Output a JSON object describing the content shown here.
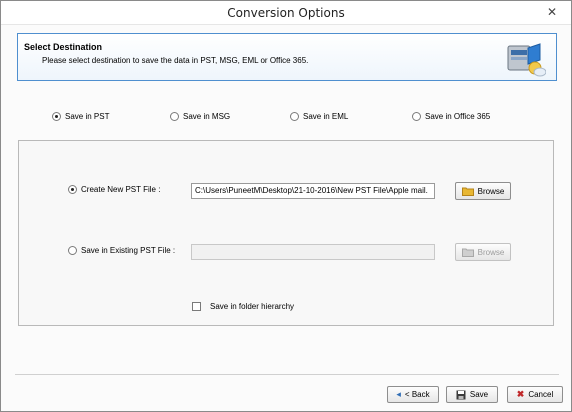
{
  "window": {
    "title": "Conversion Options",
    "close_glyph": "✕"
  },
  "header": {
    "title": "Select Destination",
    "description": "Please select destination to save the data in PST, MSG, EML or Office 365.",
    "logo_icon": "outlook-mailbox-icon"
  },
  "destinations": [
    {
      "label": "Save in PST",
      "selected": true
    },
    {
      "label": "Save in MSG",
      "selected": false
    },
    {
      "label": "Save in EML",
      "selected": false
    },
    {
      "label": "Save in Office 365",
      "selected": false
    }
  ],
  "pst_options": {
    "create_new": {
      "label": "Create New PST File :",
      "selected": true,
      "path": "C:\\Users\\PuneetM\\Desktop\\21-10-2016\\New PST File\\Apple mail.",
      "browse_label": "Browse"
    },
    "existing": {
      "label": "Save in Existing PST File :",
      "selected": false,
      "path": "",
      "browse_label": "Browse"
    },
    "folder_hierarchy": {
      "label": "Save in folder hierarchy",
      "checked": false
    }
  },
  "footer": {
    "back_label": "< Back",
    "save_label": "Save",
    "cancel_label": "Cancel"
  },
  "colors": {
    "header_border": "#4f8fcf",
    "folder_icon": "#e8b733"
  }
}
